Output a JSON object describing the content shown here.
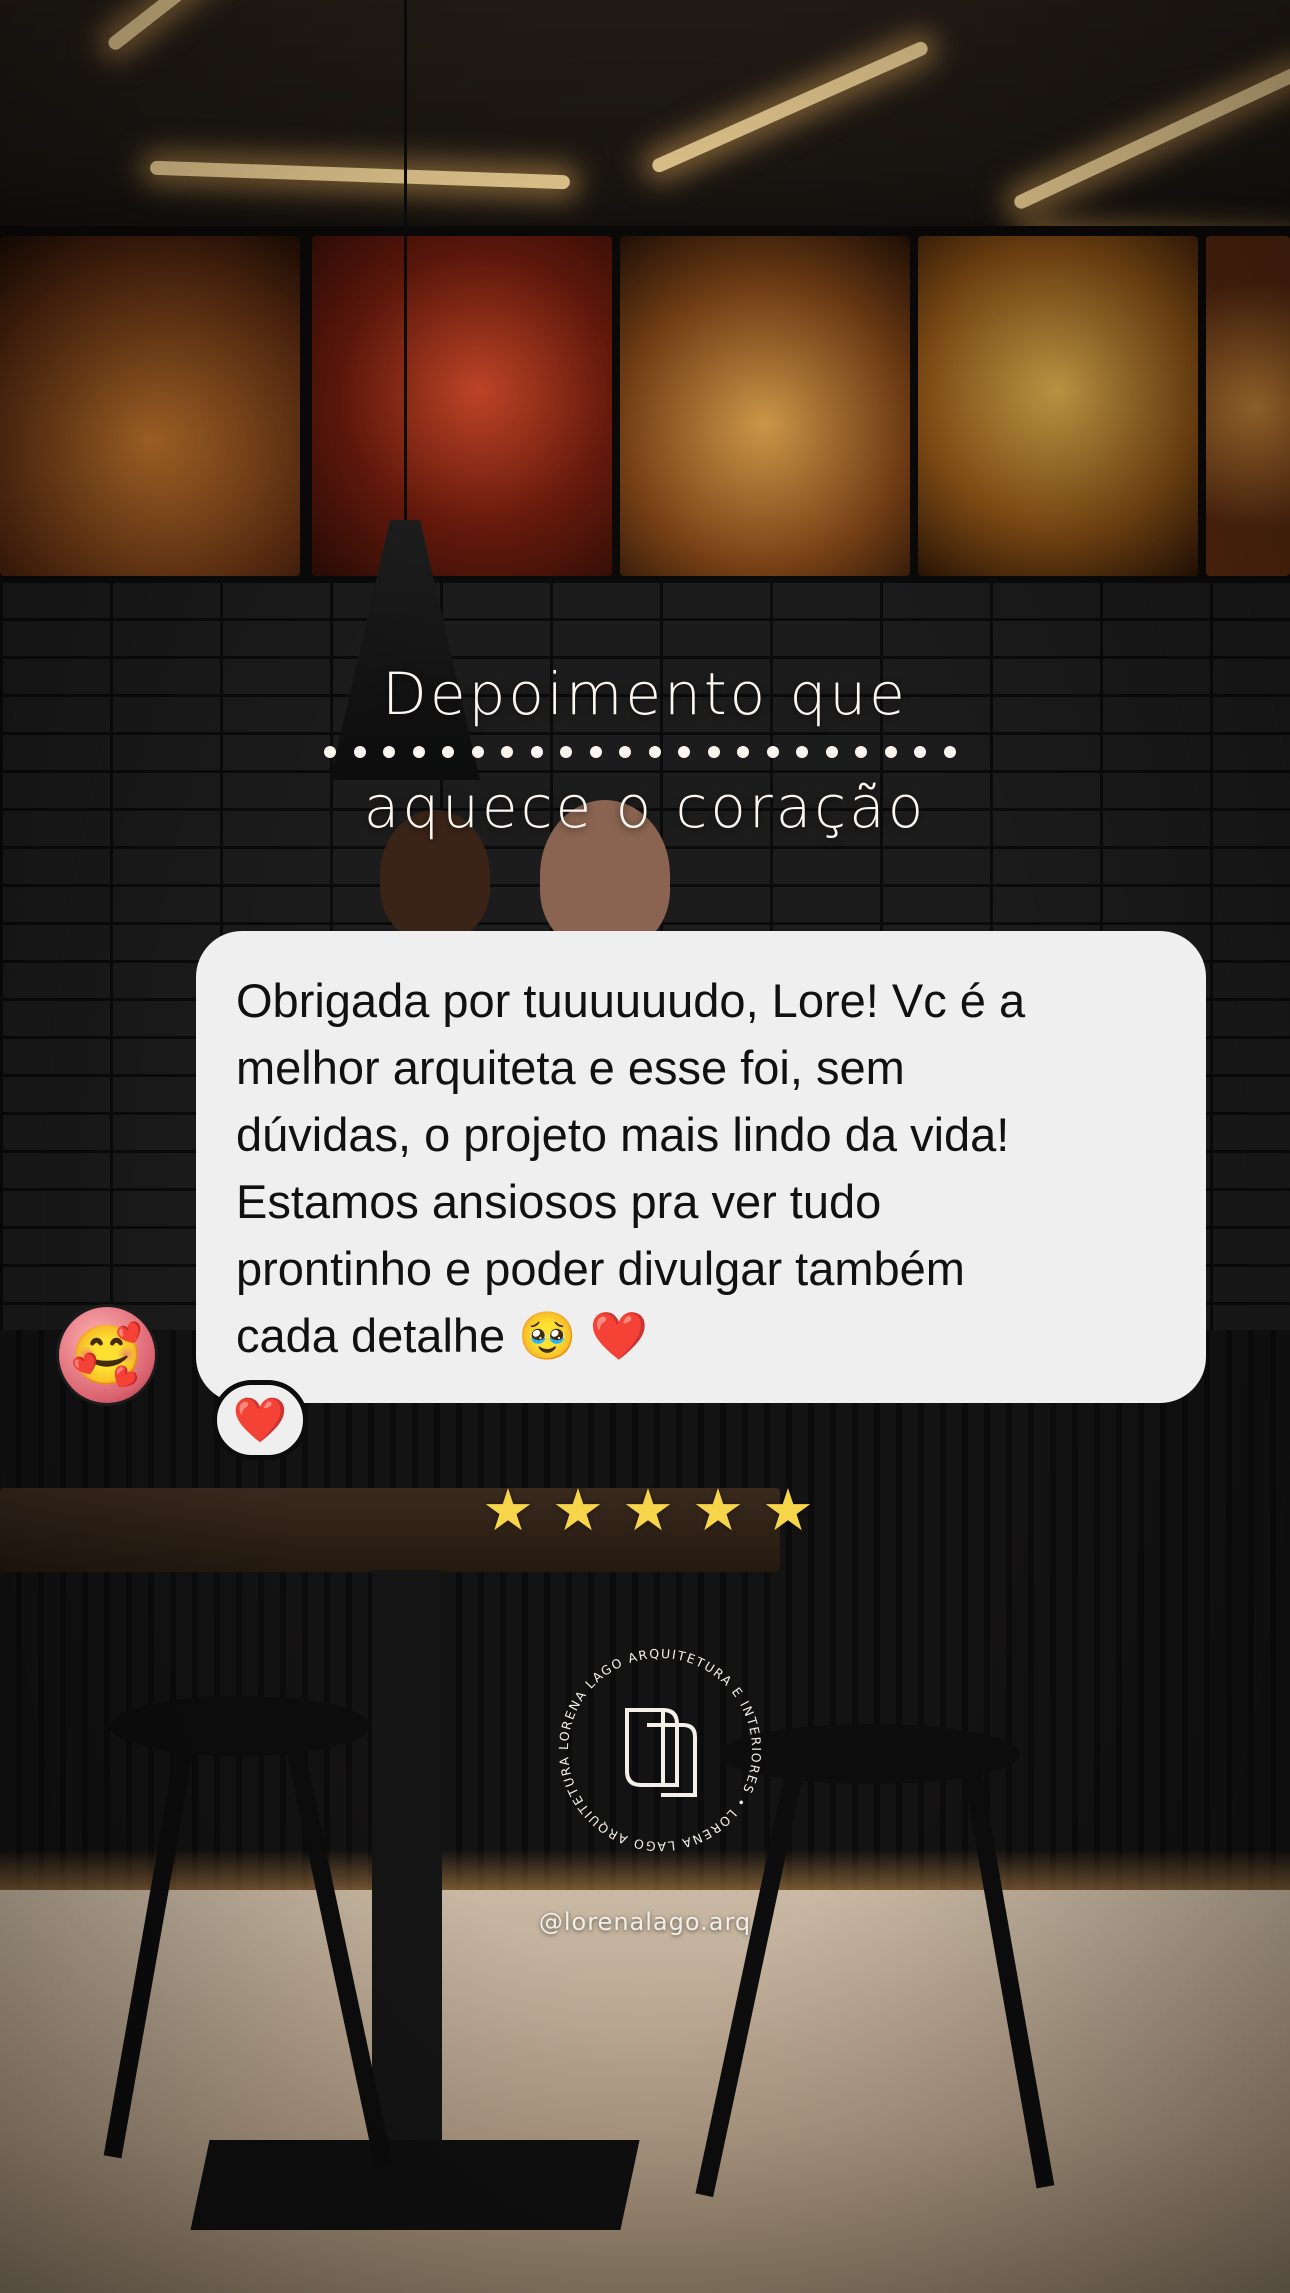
{
  "headline": {
    "line1": "Depoimento que",
    "line2": "aquece o coração"
  },
  "testimonial": {
    "text": "Obrigada por tuuuuuudo, Lore! Vc é a melhor arquiteta e esse foi, sem dúvidas, o projeto mais lindo da vida! Estamos ansiosos pra ver tudo prontinho e poder divulgar também cada detalhe 🥹 ❤️",
    "avatar_emoji": "🥰",
    "reaction": "❤️"
  },
  "rating": {
    "stars": 5,
    "max": 5,
    "star_color": "#f7d54a"
  },
  "brand": {
    "logo_ring_text": "LORENA LAGO ARQUITETURA E INTERIORES • LORENA LAGO ARQUITETURA E INTERIORES •",
    "handle": "@lorenalago.arq"
  },
  "colors": {
    "bubble": "#efefef",
    "headline": "#fbf6ef"
  }
}
